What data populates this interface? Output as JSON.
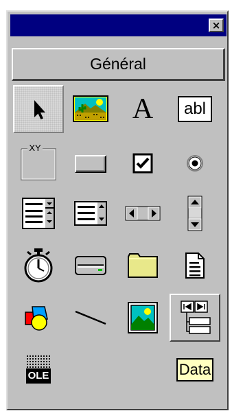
{
  "window": {
    "close_glyph": "×"
  },
  "toolbox": {
    "tab_label": "Général",
    "tools": [
      {
        "name": "pointer",
        "icon": "pointer-icon",
        "selected": true
      },
      {
        "name": "picturebox",
        "icon": "picturebox-icon"
      },
      {
        "name": "label",
        "icon": "label-icon",
        "glyph": "A"
      },
      {
        "name": "textbox",
        "icon": "textbox-icon",
        "glyph": "abl"
      },
      {
        "name": "frame",
        "icon": "frame-icon",
        "glyph": "XY"
      },
      {
        "name": "commandbutton",
        "icon": "commandbutton-icon"
      },
      {
        "name": "checkbox",
        "icon": "checkbox-icon"
      },
      {
        "name": "optionbutton",
        "icon": "optionbutton-icon"
      },
      {
        "name": "combobox",
        "icon": "combobox-icon"
      },
      {
        "name": "listbox",
        "icon": "listbox-icon"
      },
      {
        "name": "hscrollbar",
        "icon": "hscrollbar-icon"
      },
      {
        "name": "vscrollbar",
        "icon": "vscrollbar-icon"
      },
      {
        "name": "timer",
        "icon": "timer-icon"
      },
      {
        "name": "drivelistbox",
        "icon": "drivelistbox-icon"
      },
      {
        "name": "dirlistbox",
        "icon": "dirlistbox-icon"
      },
      {
        "name": "filelistbox",
        "icon": "filelistbox-icon"
      },
      {
        "name": "shape",
        "icon": "shape-icon"
      },
      {
        "name": "line",
        "icon": "line-icon"
      },
      {
        "name": "image",
        "icon": "image-icon"
      },
      {
        "name": "datacontrol-nav",
        "icon": "data-navigator-icon",
        "pressed": true
      },
      {
        "name": "ole",
        "icon": "ole-icon",
        "glyph": "OLE"
      },
      {
        "name": "data",
        "icon": "data-icon",
        "glyph": "Data"
      }
    ]
  },
  "colors": {
    "titlebar": "#000080",
    "face": "#c0c0c0",
    "folder": "#e8e88a",
    "green": "#00a000",
    "textbox_glyph_bg": "#ffffff"
  }
}
